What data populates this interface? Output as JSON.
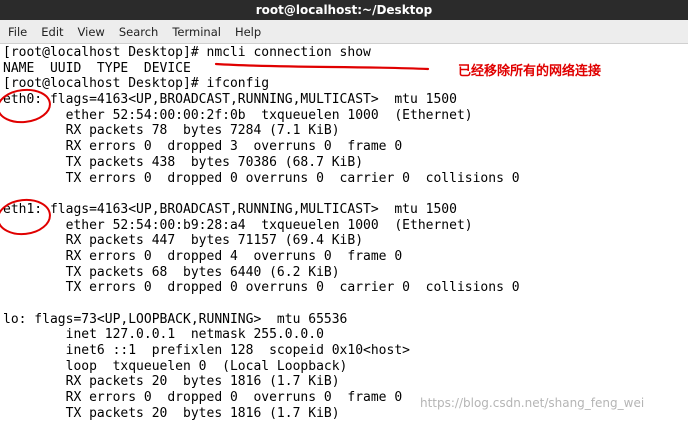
{
  "window": {
    "title": "root@localhost:~/Desktop"
  },
  "menu": {
    "items": [
      "File",
      "Edit",
      "View",
      "Search",
      "Terminal",
      "Help"
    ]
  },
  "terminal": {
    "lines": [
      "[root@localhost Desktop]# nmcli connection show",
      "NAME  UUID  TYPE  DEVICE",
      "[root@localhost Desktop]# ifconfig",
      "eth0: flags=4163<UP,BROADCAST,RUNNING,MULTICAST>  mtu 1500",
      "        ether 52:54:00:00:2f:0b  txqueuelen 1000  (Ethernet)",
      "        RX packets 78  bytes 7284 (7.1 KiB)",
      "        RX errors 0  dropped 3  overruns 0  frame 0",
      "        TX packets 438  bytes 70386 (68.7 KiB)",
      "        TX errors 0  dropped 0 overruns 0  carrier 0  collisions 0",
      "",
      "eth1: flags=4163<UP,BROADCAST,RUNNING,MULTICAST>  mtu 1500",
      "        ether 52:54:00:b9:28:a4  txqueuelen 1000  (Ethernet)",
      "        RX packets 447  bytes 71157 (69.4 KiB)",
      "        RX errors 0  dropped 4  overruns 0  frame 0",
      "        TX packets 68  bytes 6440 (6.2 KiB)",
      "        TX errors 0  dropped 0 overruns 0  carrier 0  collisions 0",
      "",
      "lo: flags=73<UP,LOOPBACK,RUNNING>  mtu 65536",
      "        inet 127.0.0.1  netmask 255.0.0.0",
      "        inet6 ::1  prefixlen 128  scopeid 0x10<host>",
      "        loop  txqueuelen 0  (Local Loopback)",
      "        RX packets 20  bytes 1816 (1.7 KiB)",
      "        RX errors 0  dropped 0  overruns 0  frame 0",
      "        TX packets 20  bytes 1816 (1.7 KiB)"
    ]
  },
  "annotation": {
    "note": "已经移除所有的网络连接",
    "color": "#e00000"
  },
  "watermark": "https://blog.csdn.net/shang_feng_wei",
  "colors": {
    "titlebar": "#2b2b2b",
    "menubar": "#ededed",
    "terminal_bg": "#ffffff",
    "terminal_fg": "#000000"
  }
}
